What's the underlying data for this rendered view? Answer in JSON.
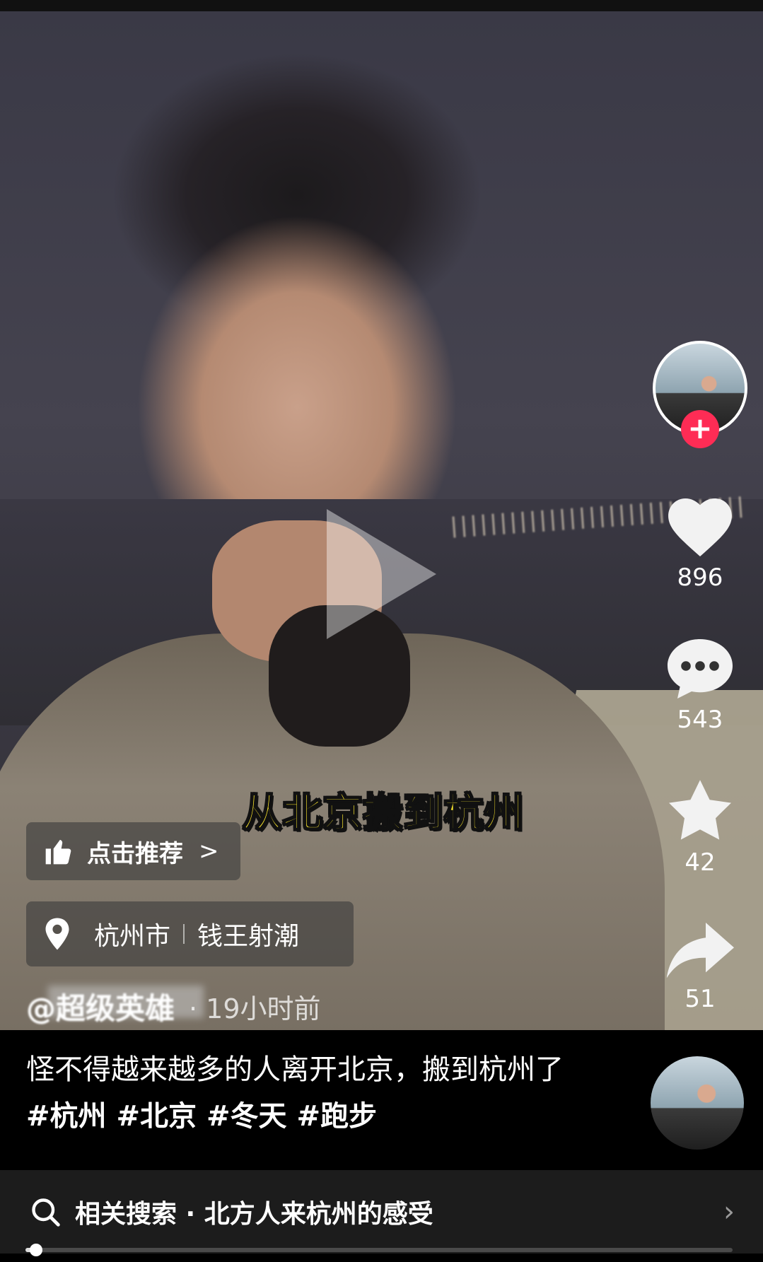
{
  "video": {
    "caption": "从北京搬到杭州",
    "recommend_label": "点击推荐",
    "location": {
      "city": "杭州市",
      "place": "钱王射潮"
    },
    "author": "@超级英雄",
    "posted": "· 19小时前"
  },
  "actions": {
    "likes": "896",
    "comments": "543",
    "favorites": "42",
    "shares": "51",
    "follow_symbol": "+"
  },
  "description": {
    "text": "怪不得越来越多的人离开北京，搬到杭州了",
    "tags": [
      "#杭州",
      "#北京",
      "#冬天",
      "#跑步"
    ]
  },
  "related_search": {
    "label": "相关搜索 · 北方人来杭州的感受",
    "arrow": "›"
  },
  "progress": {
    "fraction": 0.012
  },
  "colors": {
    "follow": "#fe2c55",
    "caption": "#ffea2d",
    "bottom_bar": "#1c1c1c"
  }
}
